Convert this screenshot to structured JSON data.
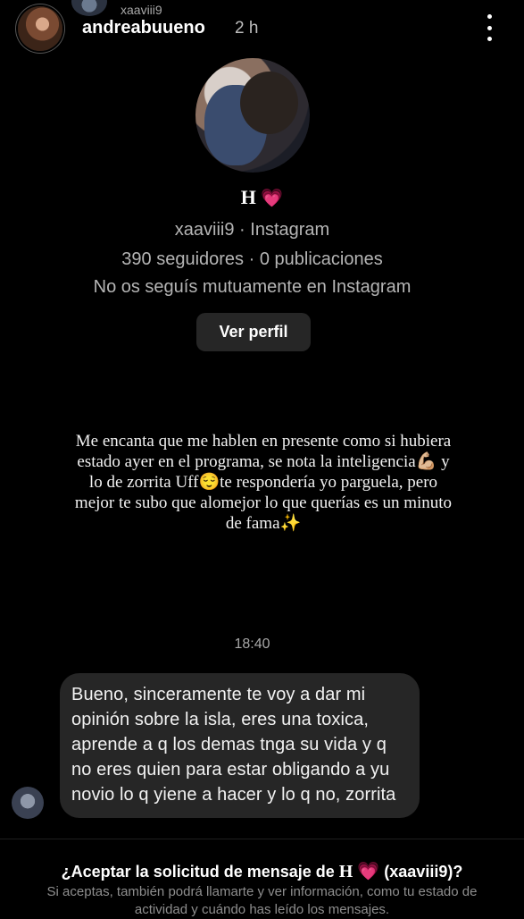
{
  "header": {
    "top_username": "xaaviii9",
    "author": "andreabuueno",
    "time": "2 h"
  },
  "profile": {
    "name": "H",
    "heart": "💗",
    "handle_line": "xaaviii9 · Instagram",
    "stats_line": "390 seguidores · 0 publicaciones",
    "follow_line": "No os seguís mutuamente en Instagram",
    "view_button": "Ver perfil"
  },
  "story_caption": "Me encanta que me hablen en presente como si hubiera estado ayer en el programa, se nota la inteligencia💪🏼 y lo de zorrita Uff😌te respondería yo parguela, pero mejor te subo que alomejor lo que querías es un minuto de fama✨",
  "timestamp": "18:40",
  "message": {
    "text": "Bueno, sinceramente te voy a dar mi opinión sobre la isla, eres una toxica, aprende a q los demas tnga su vida y q no eres quien para estar obligando a yu novio lo q yiene a hacer y lo q no, zorrita"
  },
  "request": {
    "title_start": "¿Aceptar la solicitud de mensaje de",
    "title_name": "H",
    "title_heart": "💗",
    "title_end": "(xaaviii9)?",
    "body": "Si aceptas, también podrá llamarte y ver información, como tu estado de actividad y cuándo has leído los mensajes."
  },
  "colors": {
    "background": "#000000",
    "bubble": "#262626",
    "button": "#262626",
    "heart": "#ff6fb0"
  }
}
